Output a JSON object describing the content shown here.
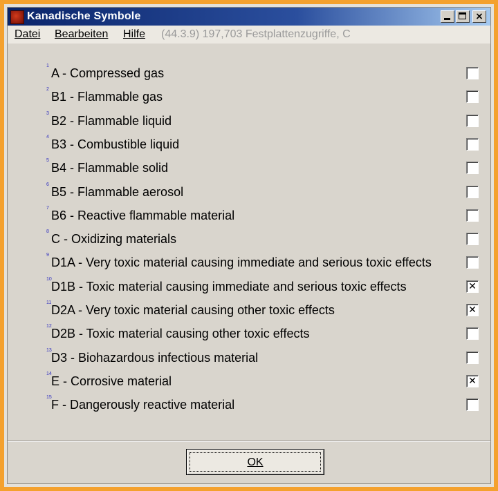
{
  "window": {
    "title": "Kanadische Symbole",
    "controls": {
      "minimize": "minimize",
      "maximize": "maximize",
      "close": "×"
    }
  },
  "menu": {
    "file": "Datei",
    "edit": "Bearbeiten",
    "help": "Hilfe",
    "status": "(44.3.9) 197,703 Festplattenzugriffe, C"
  },
  "items": [
    {
      "num": "1",
      "label": "A - Compressed gas",
      "checked": false
    },
    {
      "num": "2",
      "label": "B1 - Flammable gas",
      "checked": false
    },
    {
      "num": "3",
      "label": "B2 - Flammable liquid",
      "checked": false
    },
    {
      "num": "4",
      "label": "B3 - Combustible liquid",
      "checked": false
    },
    {
      "num": "5",
      "label": "B4 - Flammable solid",
      "checked": false
    },
    {
      "num": "6",
      "label": "B5 - Flammable aerosol",
      "checked": false
    },
    {
      "num": "7",
      "label": "B6 - Reactive flammable material",
      "checked": false
    },
    {
      "num": "8",
      "label": "C - Oxidizing materials",
      "checked": false
    },
    {
      "num": "9",
      "label": "D1A - Very toxic material causing immediate and serious toxic effects",
      "checked": false
    },
    {
      "num": "10",
      "label": "D1B - Toxic material causing immediate and serious toxic effects",
      "checked": true
    },
    {
      "num": "11",
      "label": "D2A - Very toxic material causing other toxic effects",
      "checked": true
    },
    {
      "num": "12",
      "label": "D2B - Toxic material causing other toxic effects",
      "checked": false
    },
    {
      "num": "13",
      "label": "D3 - Biohazardous infectious material",
      "checked": false
    },
    {
      "num": "14",
      "label": "E - Corrosive material",
      "checked": true
    },
    {
      "num": "15",
      "label": "F - Dangerously reactive material",
      "checked": false
    }
  ],
  "footer": {
    "ok_label": "OK"
  },
  "colors": {
    "frame": "#f4a12e",
    "titlebar": "#0a246a",
    "dialog": "#d9d5cd"
  }
}
